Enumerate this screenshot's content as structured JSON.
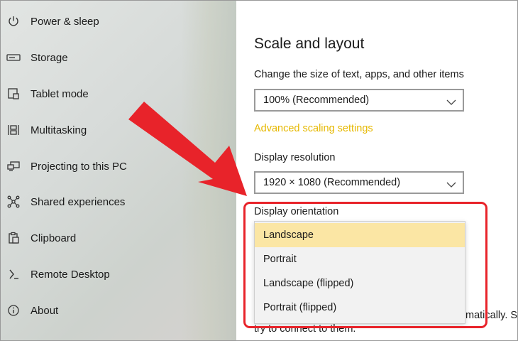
{
  "sidebar": {
    "items": [
      {
        "label": "Power & sleep",
        "icon": "power-icon"
      },
      {
        "label": "Storage",
        "icon": "storage-icon"
      },
      {
        "label": "Tablet mode",
        "icon": "tablet-icon"
      },
      {
        "label": "Multitasking",
        "icon": "multitasking-icon"
      },
      {
        "label": "Projecting to this PC",
        "icon": "projecting-icon"
      },
      {
        "label": "Shared experiences",
        "icon": "shared-experiences-icon"
      },
      {
        "label": "Clipboard",
        "icon": "clipboard-icon"
      },
      {
        "label": "Remote Desktop",
        "icon": "remote-desktop-icon"
      },
      {
        "label": "About",
        "icon": "info-icon"
      }
    ]
  },
  "main": {
    "section_title": "Scale and layout",
    "scale_label": "Change the size of text, apps, and other items",
    "scale_value": "100% (Recommended)",
    "advanced_link": "Advanced scaling settings",
    "resolution_label": "Display resolution",
    "resolution_value": "1920 × 1080 (Recommended)",
    "orientation_label": "Display orientation",
    "orientation_options": [
      "Landscape",
      "Portrait",
      "Landscape (flipped)",
      "Portrait (flipped)"
    ],
    "orientation_selected": "Landscape",
    "partial_text_1": "matically. S",
    "partial_text_2": "try to connect to them."
  },
  "colors": {
    "accent_link": "#e6b800",
    "selected_option_bg": "#fbe6a4",
    "annotation_red": "#e8232a"
  }
}
